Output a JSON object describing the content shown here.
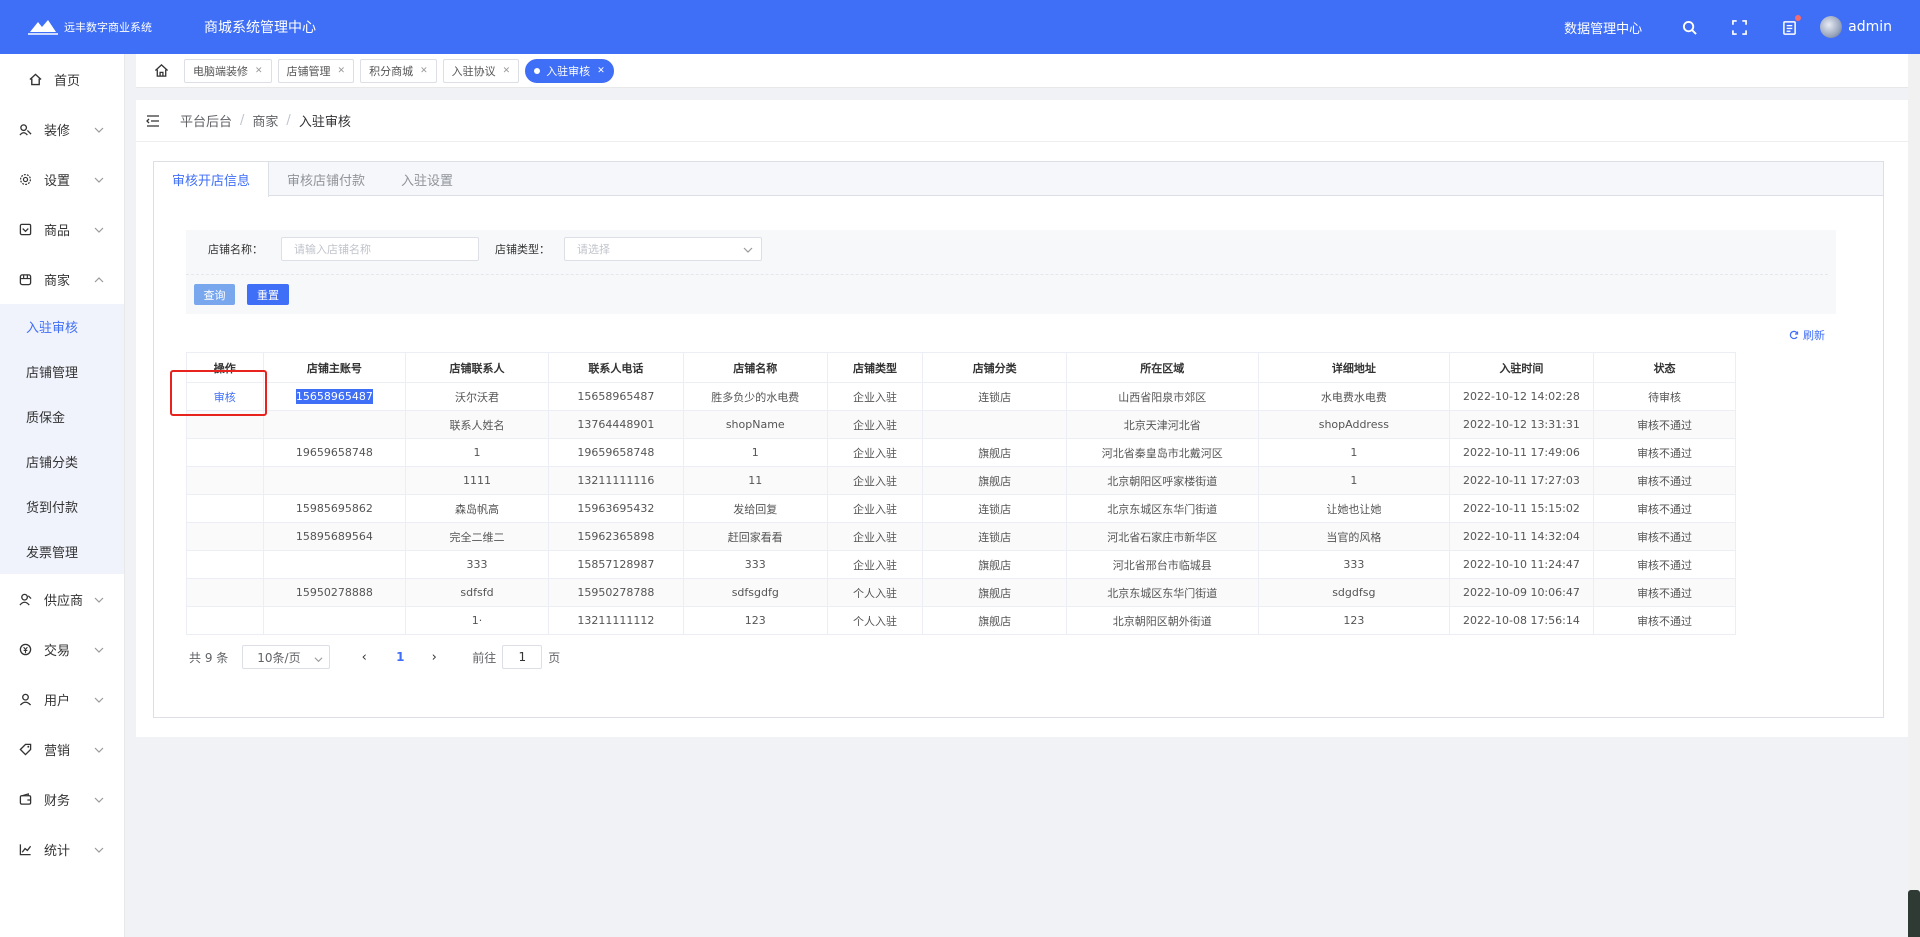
{
  "header": {
    "logo_text": "远丰数字商业系统",
    "title": "商城系统管理中心",
    "data_center": "数据管理中心",
    "username": "admin"
  },
  "sidebar": {
    "items": [
      {
        "label": "首页",
        "icon": "home-icon"
      },
      {
        "label": "装修",
        "icon": "decorate-icon"
      },
      {
        "label": "设置",
        "icon": "gear-icon"
      },
      {
        "label": "商品",
        "icon": "goods-icon"
      },
      {
        "label": "商家",
        "icon": "store-icon",
        "expanded": true
      },
      {
        "label": "供应商",
        "icon": "supplier-icon"
      },
      {
        "label": "交易",
        "icon": "trade-icon"
      },
      {
        "label": "用户",
        "icon": "user-icon"
      },
      {
        "label": "营销",
        "icon": "tag-icon"
      },
      {
        "label": "财务",
        "icon": "wallet-icon"
      },
      {
        "label": "统计",
        "icon": "chart-icon"
      }
    ],
    "sub_items": [
      "入驻审核",
      "店铺管理",
      "质保金",
      "店铺分类",
      "货到付款",
      "发票管理"
    ]
  },
  "tabs": [
    "电脑端装修",
    "店铺管理",
    "积分商城",
    "入驻协议",
    "入驻审核"
  ],
  "breadcrumb": [
    "平台后台",
    "商家",
    "入驻审核"
  ],
  "panel_tabs": [
    "审核开店信息",
    "审核店铺付款",
    "入驻设置"
  ],
  "filters": {
    "shop_name_label": "店铺名称：",
    "shop_name_placeholder": "请输入店铺名称",
    "shop_type_label": "店铺类型：",
    "shop_type_placeholder": "请选择",
    "query_btn": "查询",
    "reset_btn": "重置"
  },
  "refresh_label": "刷新",
  "table": {
    "columns": [
      "操作",
      "店铺主账号",
      "店铺联系人",
      "联系人电话",
      "店铺名称",
      "店铺类型",
      "店铺分类",
      "所在区域",
      "详细地址",
      "入驻时间",
      "状态"
    ],
    "action_label": "审核",
    "rows": [
      [
        "审核",
        "15658965487",
        "沃尔沃君",
        "15658965487",
        "胜多负少的水电费",
        "企业入驻",
        "连锁店",
        "山西省阳泉市郊区",
        "水电费水电费",
        "2022-10-12 14:02:28",
        "待审核"
      ],
      [
        "",
        "",
        "联系人姓名",
        "13764448901",
        "shopName",
        "企业入驻",
        "",
        "北京天津河北省",
        "shopAddress",
        "2022-10-12 13:31:31",
        "审核不通过"
      ],
      [
        "",
        "19659658748",
        "1",
        "19659658748",
        "1",
        "企业入驻",
        "旗舰店",
        "河北省秦皇岛市北戴河区",
        "1",
        "2022-10-11 17:49:06",
        "审核不通过"
      ],
      [
        "",
        "",
        "1111",
        "13211111116",
        "11",
        "企业入驻",
        "旗舰店",
        "北京朝阳区呼家楼街道",
        "1",
        "2022-10-11 17:27:03",
        "审核不通过"
      ],
      [
        "",
        "15985695862",
        "森岛帆高",
        "15963695432",
        "发给回复",
        "企业入驻",
        "连锁店",
        "北京东城区东华门街道",
        "让她也让她",
        "2022-10-11 15:15:02",
        "审核不通过"
      ],
      [
        "",
        "15895689564",
        "完全二维二",
        "15962365898",
        "赶回家看看",
        "企业入驻",
        "连锁店",
        "河北省石家庄市新华区",
        "当官的风格",
        "2022-10-11 14:32:04",
        "审核不通过"
      ],
      [
        "",
        "",
        "333",
        "15857128987",
        "333",
        "企业入驻",
        "旗舰店",
        "河北省邢台市临城县",
        "333",
        "2022-10-10 11:24:47",
        "审核不通过"
      ],
      [
        "",
        "15950278888",
        "sdfsfd",
        "15950278788",
        "sdfsgdfg",
        "个人入驻",
        "旗舰店",
        "北京东城区东华门街道",
        "sdgdfsg",
        "2022-10-09 10:06:47",
        "审核不通过"
      ],
      [
        "",
        "",
        "1·",
        "13211111112",
        "123",
        "个人入驻",
        "旗舰店",
        "北京朝阳区朝外街道",
        "123",
        "2022-10-08 17:56:14",
        "审核不通过"
      ]
    ]
  },
  "pagination": {
    "total": "共 9 条",
    "page_size": "10条/页",
    "current": "1",
    "goto_prefix": "前往",
    "goto_value": "1",
    "goto_suffix": "页"
  },
  "colors": {
    "primary": "#3f6ef7",
    "highlight_box": "#e8231e"
  }
}
